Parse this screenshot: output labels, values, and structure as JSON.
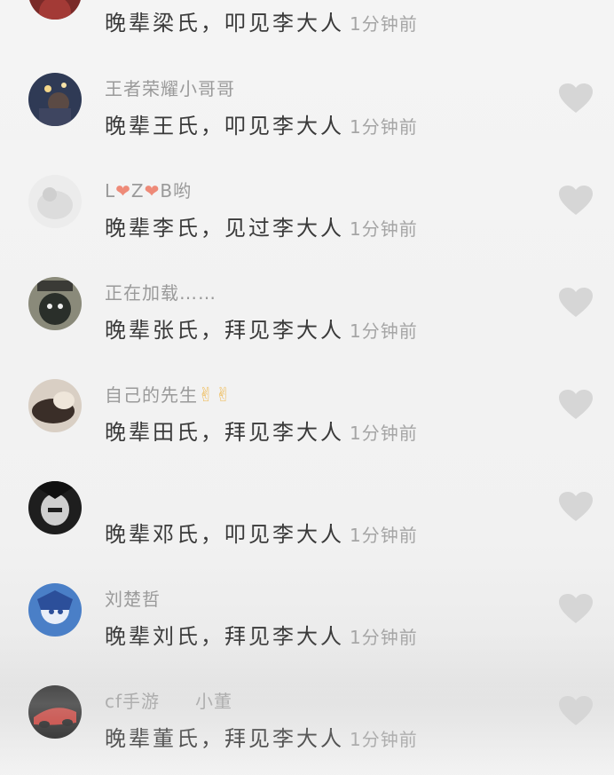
{
  "comments": [
    {
      "username": "",
      "text": "晚辈梁氏，叩见李大人",
      "time": "1分钟前"
    },
    {
      "username": "王者荣耀小哥哥",
      "text": "晚辈王氏，叩见李大人",
      "time": "1分钟前"
    },
    {
      "username_parts": [
        "L",
        "❤",
        "Z",
        "❤",
        "B哟"
      ],
      "text": "晚辈李氏，见过李大人",
      "time": "1分钟前"
    },
    {
      "username": "正在加载……",
      "text": "晚辈张氏，拜见李大人",
      "time": "1分钟前"
    },
    {
      "username": "自己的先生",
      "username_emoji": "✌✌",
      "text": "晚辈田氏，拜见李大人",
      "time": "1分钟前"
    },
    {
      "username": "",
      "text": "晚辈邓氏，叩见李大人",
      "time": "1分钟前"
    },
    {
      "username": "刘楚哲",
      "text": "晚辈刘氏，拜见李大人",
      "time": "1分钟前"
    },
    {
      "username_parts": [
        "cf手游",
        "小董"
      ],
      "text": "晚辈董氏，拜见李大人",
      "time": "1分钟前"
    }
  ],
  "icons": {
    "like": "heart-icon"
  },
  "colors": {
    "background": "#f2f2f2",
    "username": "#9a9a9a",
    "comment_text": "#3a3a3a",
    "time": "#a5a5a5",
    "like_heart": "#d6d6d6",
    "username_heart": "#ee8a78"
  }
}
